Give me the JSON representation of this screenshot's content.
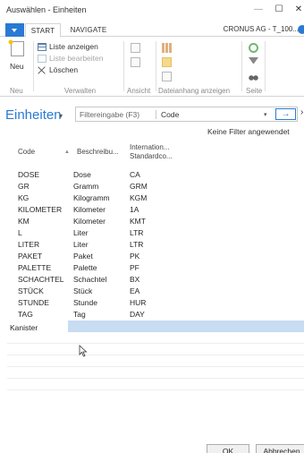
{
  "window": {
    "title": "Auswählen - Einheiten",
    "minimize": "—",
    "maximize": "☐",
    "close": "✕"
  },
  "ribbon": {
    "tabs": [
      "START",
      "NAVIGATE"
    ],
    "company": "CRONUS AG - T_100...",
    "groups": {
      "neu": {
        "label": "Neu",
        "new_button": "Neu"
      },
      "verwalten": {
        "label": "Verwalten",
        "list_view": "Liste anzeigen",
        "list_edit": "Liste bearbeiten",
        "delete": "Löschen"
      },
      "ansicht": {
        "label": "Ansicht"
      },
      "attachment": {
        "label": "Dateianhang anzeigen"
      },
      "seite": {
        "label": "Seite"
      }
    }
  },
  "header": {
    "title": "Einheiten",
    "title_chevron": "▾",
    "filter_placeholder": "Filtereingabe (F3)",
    "filter_field": "Code",
    "field_chevron": "▾",
    "apply_icon": "→",
    "expand_icon": "›",
    "no_filter": "Keine Filter angewendet"
  },
  "table": {
    "columns": [
      "Code",
      "Beschreibu...",
      "Internation... Standardco..."
    ],
    "sort_caret": "▲",
    "rows": [
      {
        "code": "DOSE",
        "desc": "Dose",
        "intl": "CA"
      },
      {
        "code": "GR",
        "desc": "Gramm",
        "intl": "GRM"
      },
      {
        "code": "KG",
        "desc": "Kilogramm",
        "intl": "KGM"
      },
      {
        "code": "KILOMETER",
        "desc": "Kilometer",
        "intl": "1A"
      },
      {
        "code": "KM",
        "desc": "Kilometer",
        "intl": "KMT"
      },
      {
        "code": "L",
        "desc": "Liter",
        "intl": "LTR"
      },
      {
        "code": "LITER",
        "desc": "Liter",
        "intl": "LTR"
      },
      {
        "code": "PAKET",
        "desc": "Paket",
        "intl": "PK"
      },
      {
        "code": "PALETTE",
        "desc": "Palette",
        "intl": "PF"
      },
      {
        "code": "SCHACHTEL",
        "desc": "Schachtel",
        "intl": "BX"
      },
      {
        "code": "STÜCK",
        "desc": "Stück",
        "intl": "EA"
      },
      {
        "code": "STUNDE",
        "desc": "Stunde",
        "intl": "HUR"
      },
      {
        "code": "TAG",
        "desc": "Tag",
        "intl": "DAY"
      }
    ],
    "editing_value": "Kanister"
  },
  "footer": {
    "ok": "OK",
    "cancel": "Abbrechen"
  },
  "colors": {
    "accent": "#2a7ad3",
    "selection": "#c8dcf2"
  }
}
